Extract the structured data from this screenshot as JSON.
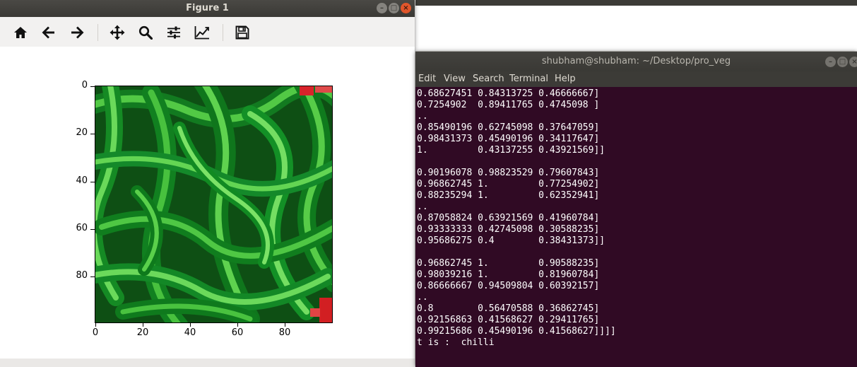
{
  "figure": {
    "title": "Figure 1",
    "toolbar": {
      "home": "home-icon",
      "back": "back-arrow-icon",
      "forward": "forward-arrow-icon",
      "pan": "pan-move-icon",
      "zoom": "zoom-magnifier-icon",
      "configure": "configure-subplots-icon",
      "edit": "edit-axis-icon",
      "save": "save-floppy-icon"
    },
    "plot": {
      "yticks": [
        "0",
        "20",
        "40",
        "60",
        "80"
      ],
      "xticks": [
        "0",
        "20",
        "40",
        "60",
        "80"
      ],
      "image_subject": "green chilli peppers"
    }
  },
  "terminal": {
    "title": "shubham@shubham: ~/Desktop/pro_veg",
    "menu": [
      "Edit",
      "View",
      "Search",
      "Terminal",
      "Help"
    ],
    "lines": [
      "0.68627451 0.84313725 0.46666667]",
      "0.7254902  0.89411765 0.4745098 ]",
      "..",
      "0.85490196 0.62745098 0.37647059]",
      "0.98431373 0.45490196 0.34117647]",
      "1.         0.43137255 0.43921569]]",
      "",
      "0.90196078 0.98823529 0.79607843]",
      "0.96862745 1.         0.77254902]",
      "0.88235294 1.         0.62352941]",
      "..",
      "0.87058824 0.63921569 0.41960784]",
      "0.93333333 0.42745098 0.30588235]",
      "0.95686275 0.4        0.38431373]]",
      "",
      "0.96862745 1.         0.90588235]",
      "0.98039216 1.         0.81960784]",
      "0.86666667 0.94509804 0.60392157]",
      "..",
      "0.8        0.56470588 0.36862745]",
      "0.92156863 0.41568627 0.29411765]",
      "0.99215686 0.45490196 0.41568627]]]]",
      "t is :  chilli"
    ]
  },
  "colors": {
    "terminal_bg": "#300a24",
    "titlebar": "#3c3b37",
    "close_button": "#e0562b",
    "chilli_green": "#1e8a2a"
  }
}
